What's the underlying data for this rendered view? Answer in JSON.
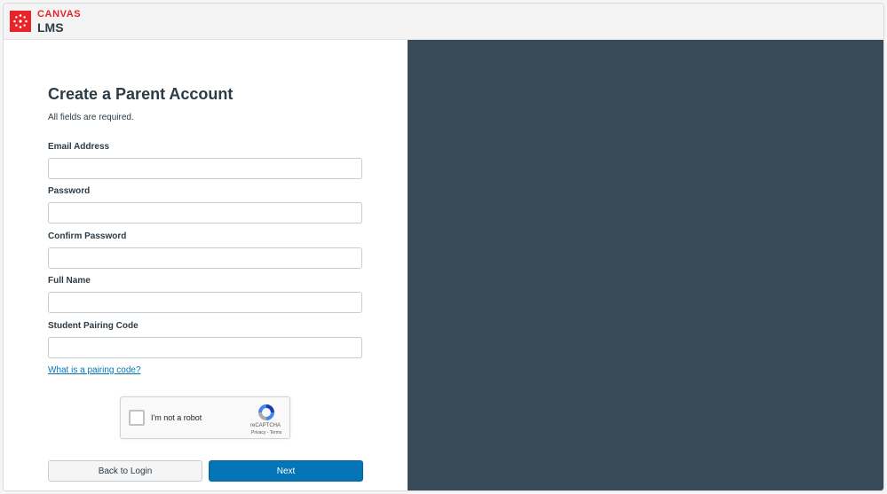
{
  "header": {
    "brand_top": "CANVAS",
    "brand_bottom": "LMS",
    "logo_icon": "canvas-logo-icon",
    "brand_color": "#e62429"
  },
  "form": {
    "title": "Create a Parent Account",
    "subtitle": "All fields are required.",
    "fields": [
      {
        "label": "Email Address",
        "value": "",
        "placeholder": ""
      },
      {
        "label": "Password",
        "value": "",
        "placeholder": ""
      },
      {
        "label": "Confirm Password",
        "value": "",
        "placeholder": ""
      },
      {
        "label": "Full Name",
        "value": "",
        "placeholder": ""
      },
      {
        "label": "Student Pairing Code",
        "value": "",
        "placeholder": ""
      }
    ],
    "pairing_link": "What is a pairing code?",
    "captcha": {
      "label": "I'm not a robot",
      "brand": "reCAPTCHA",
      "links": "Privacy - Terms",
      "checked": false
    },
    "buttons": {
      "back": "Back to Login",
      "next": "Next"
    }
  },
  "colors": {
    "accent": "#0374b5",
    "side_panel": "#394b58",
    "text": "#2d3b45"
  }
}
